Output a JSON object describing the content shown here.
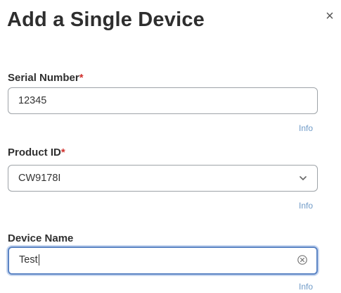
{
  "dialog": {
    "title": "Add a Single Device",
    "close_glyph": "×"
  },
  "fields": {
    "serial": {
      "label": "Serial Number",
      "required_mark": "*",
      "value": "12345",
      "info": "Info"
    },
    "product": {
      "label": "Product ID",
      "required_mark": "*",
      "value": "CW9178I",
      "info": "Info",
      "icon": "chevron-down-icon"
    },
    "device_name": {
      "label": "Device Name",
      "value": "Test",
      "info": "Info",
      "icon": "clear-circle-icon"
    }
  },
  "colors": {
    "required": "#d0312d",
    "info_link": "#6f9ac7",
    "focus_border": "#5b84c4"
  }
}
